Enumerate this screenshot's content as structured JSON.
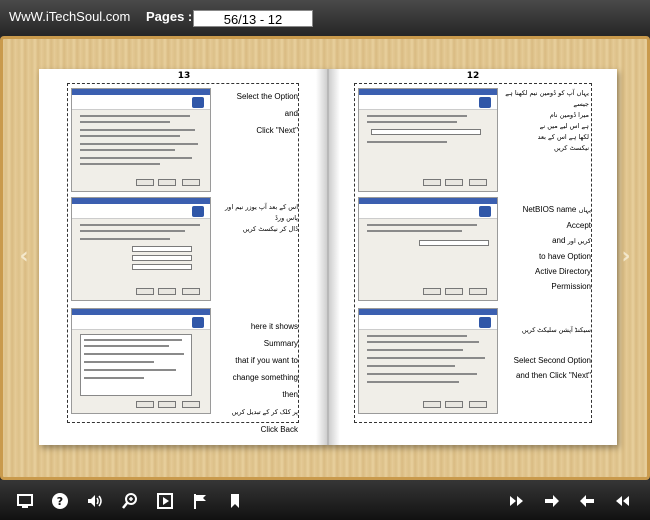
{
  "header": {
    "site_title": "WwW.iTechSoul.com",
    "pages_label": "Pages :",
    "page_value": "56/13 - 12"
  },
  "book": {
    "left_page_number": "13",
    "right_page_number": "12",
    "left_page": {
      "english_text_1": "Select the Option and",
      "english_text_1b": "Click \"Next\"",
      "urdu_text_2": "اس کے بعد آپ یوزر نیم اور پاس ورڈ",
      "urdu_text_2b": "ڈال کر نیکسٹ کریں",
      "english_text_3": "here it shows Summary",
      "english_text_3b": "that if you want to",
      "english_text_3c": "change something then",
      "english_text_3d": "Click Back",
      "urdu_text_3": "پر کلک کر کے تبدیل کریں"
    },
    "right_page": {
      "urdu_text_1": "یہاں آپ کو ڈومین نیم لکھنا ہے جیسے",
      "urdu_text_1b": "میرا ڈومین نام",
      "urdu_text_1c": "ہے اس لیے میں نے",
      "urdu_text_1d": "لکھا ہے اس کے بعد",
      "urdu_text_1e": "نیکسٹ کریں",
      "english_netbios": "NetBIOS name",
      "urdu_text_2": "یہاں",
      "english_accept": "Accept",
      "urdu_text_2b": "کریں اور",
      "english_and": "and",
      "english_have": "to have",
      "english_option": "Option",
      "english_ad": "Active Directory",
      "english_permission": "Permission",
      "urdu_text_3": "سیکنڈ آپشن سلیکٹ کریں",
      "english_select": "Select Second Option",
      "english_then": "and then Click \"Next\""
    }
  },
  "toolbar": {
    "screen_icon": "screen-icon",
    "help_icon": "help-icon",
    "sound_icon": "sound-icon",
    "zoom_icon": "zoom-icon",
    "play_icon": "play-icon",
    "flag_icon": "flag-icon",
    "bookmark_icon": "bookmark-icon",
    "last_page_icon": "last-page-icon",
    "next_page_icon": "next-page-icon",
    "prev_page_icon": "prev-page-icon",
    "first_page_icon": "first-page-icon"
  },
  "colors": {
    "wood": "#e3c893",
    "wood_border": "#c99a4c",
    "toolbar": "#1c1c1c",
    "dialog_title": "#3b5fb0"
  }
}
